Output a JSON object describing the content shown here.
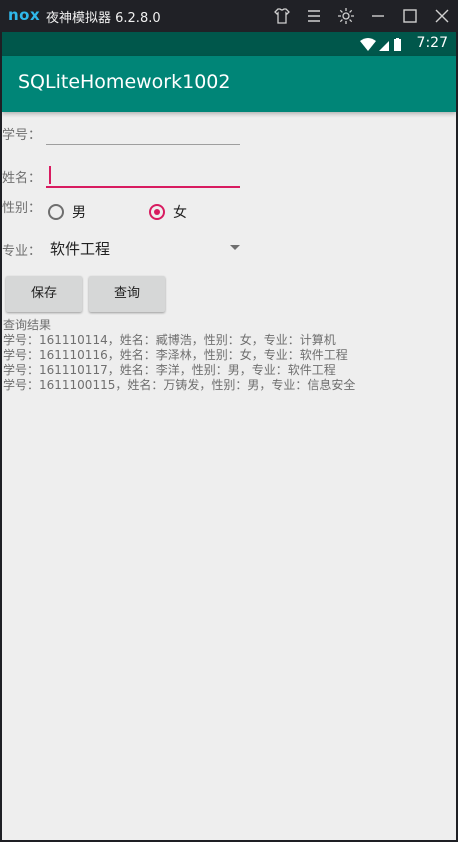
{
  "emulator": {
    "logo": "nox",
    "title": "夜神模拟器 6.2.8.0",
    "controls": [
      "tshirt-icon",
      "menu-icon",
      "gear-icon",
      "minimize-icon",
      "maximize-icon",
      "close-icon"
    ]
  },
  "status_bar": {
    "time": "7:27",
    "icons": [
      "wifi-icon",
      "signal-icon",
      "battery-icon"
    ]
  },
  "app_bar": {
    "title": "SQLiteHomework1002",
    "color": "#008577"
  },
  "form": {
    "student_id_label": "学号：",
    "student_id_value": "",
    "name_label": "姓名：",
    "name_value": "",
    "gender_label": "性别：",
    "gender_options": [
      "男",
      "女"
    ],
    "gender_selected": "女",
    "major_label": "专业：",
    "major_selected": "软件工程",
    "accent_color": "#d81b60"
  },
  "buttons": {
    "save_label": "保存",
    "query_label": "查询"
  },
  "results": {
    "header": "查询结果",
    "rows": [
      "学号：161110114，姓名：臧博浩，性别：女，专业：计算机",
      "学号：161110116，姓名：李泽林，性别：女，专业：软件工程",
      "学号：161110117，姓名：李洋，性别：男，专业：软件工程",
      "学号：1611100115，姓名：万铸发，性别：男，专业：信息安全"
    ]
  }
}
